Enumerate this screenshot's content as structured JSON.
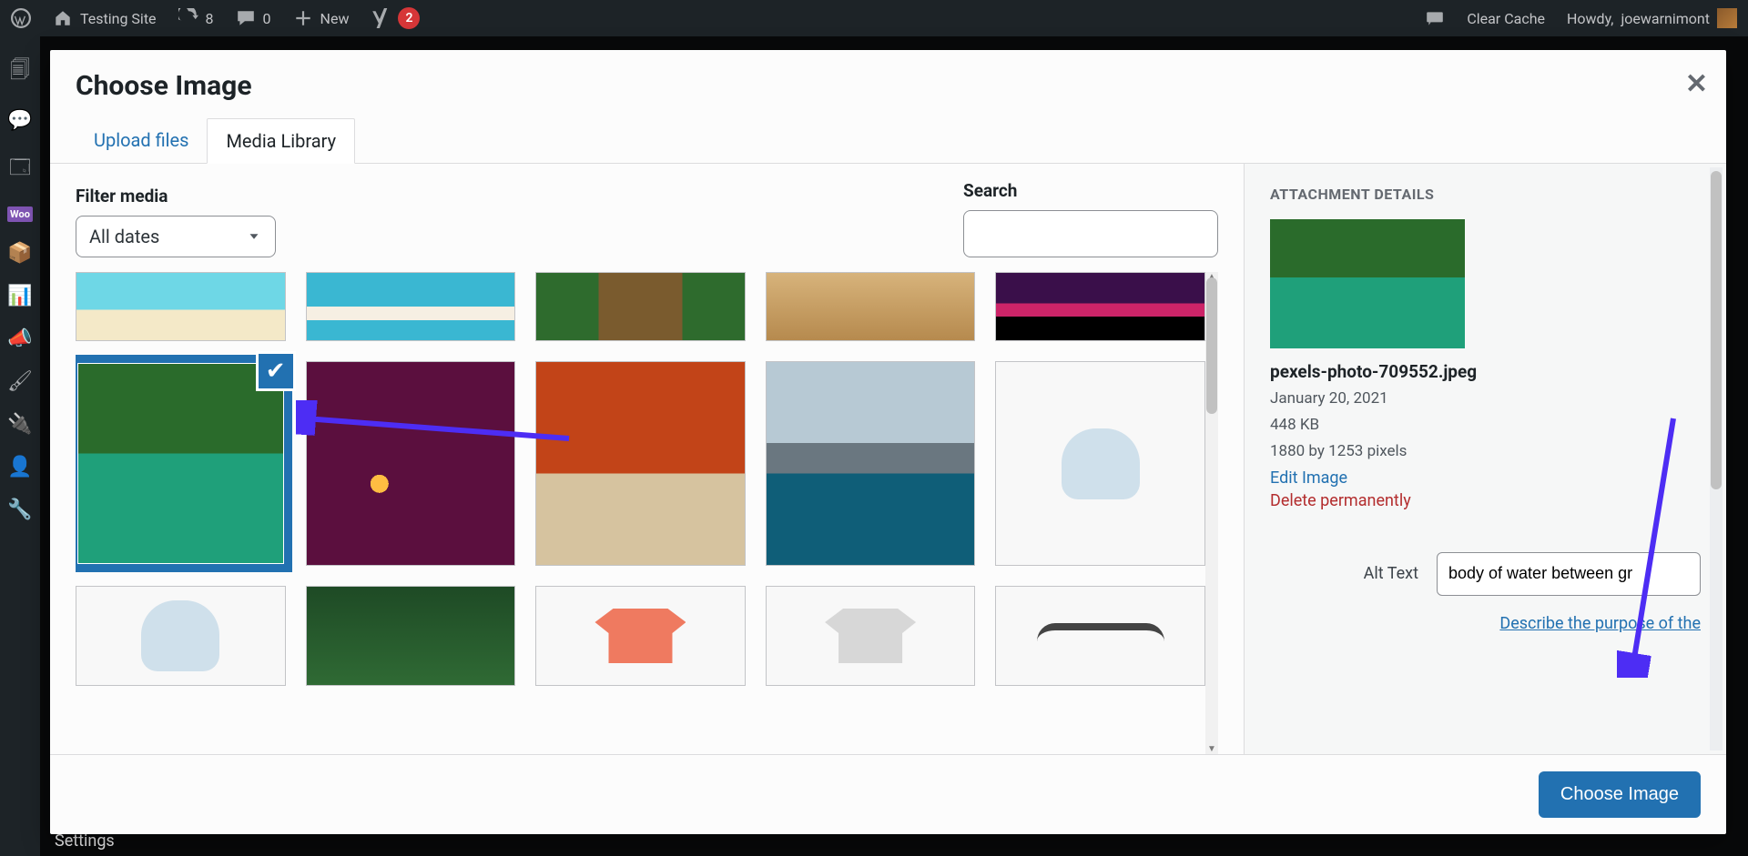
{
  "adminbar": {
    "site_title": "Testing Site",
    "updates_count": "8",
    "comments_count": "0",
    "new_label": "New",
    "yoast_count": "2",
    "clear_cache": "Clear Cache",
    "howdy_prefix": "Howdy, ",
    "username": "joewarnimont"
  },
  "admin_menu": {
    "settings_label": "Settings",
    "woo_label": "Woo"
  },
  "modal": {
    "title": "Choose Image",
    "tabs": {
      "upload": "Upload files",
      "library": "Media Library"
    },
    "filter_label": "Filter media",
    "date_filter_value": "All dates",
    "search_label": "Search",
    "search_value": "",
    "choose_button": "Choose Image"
  },
  "sidebar": {
    "heading": "ATTACHMENT DETAILS",
    "filename": "pexels-photo-709552.jpeg",
    "date": "January 20, 2021",
    "filesize": "448 KB",
    "dimensions": "1880 by 1253 pixels",
    "edit_label": "Edit Image",
    "delete_label": "Delete permanently",
    "alt_label": "Alt Text",
    "alt_value": "body of water between gr",
    "describe_link": "Describe the purpose of the"
  },
  "thumbs": {
    "row0": [
      "beach",
      "island",
      "bridge",
      "desert",
      "sunset"
    ],
    "row1": [
      "forest-river",
      "red-sunset",
      "autumn-path",
      "mountain-lake",
      "hoodie"
    ],
    "row2": [
      "hoodie-blue",
      "pines",
      "tshirt",
      "tshirt-grey",
      "glasses"
    ],
    "selected_index": 5
  }
}
